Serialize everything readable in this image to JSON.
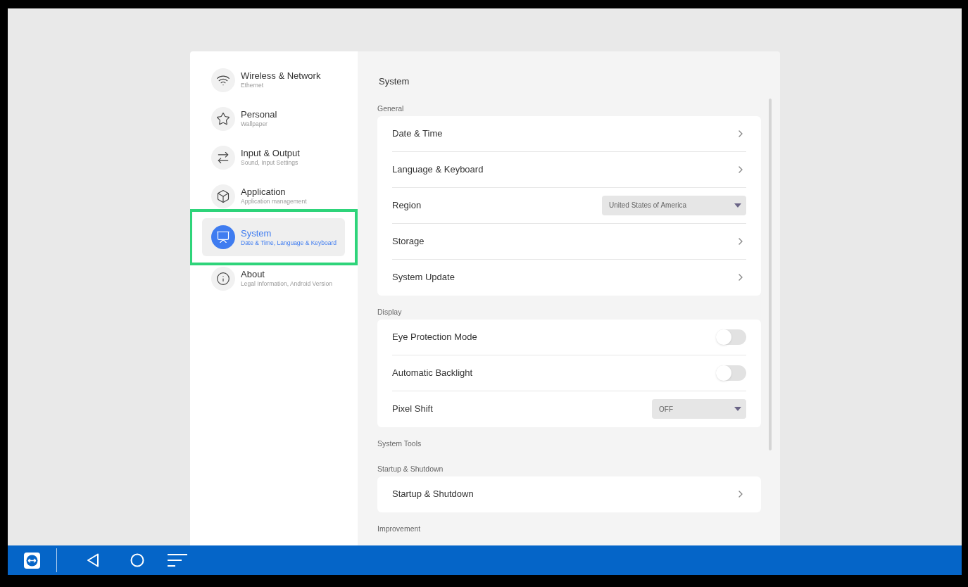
{
  "sidebar": {
    "items": [
      {
        "kind": "wifi",
        "label": "Wireless & Network",
        "sublabel": "Ethernet",
        "selected": false,
        "highlighted": false
      },
      {
        "kind": "star",
        "label": "Personal",
        "sublabel": "Wallpaper",
        "selected": false,
        "highlighted": false
      },
      {
        "kind": "arrows",
        "label": "Input & Output",
        "sublabel": "Sound, Input Settings",
        "selected": false,
        "highlighted": false
      },
      {
        "kind": "cube",
        "label": "Application",
        "sublabel": "Application management",
        "selected": false,
        "highlighted": false
      },
      {
        "kind": "monitor",
        "label": "System",
        "sublabel": "Date & Time, Language & Keyboard",
        "selected": true,
        "highlighted": true
      },
      {
        "kind": "info",
        "label": "About",
        "sublabel": "Legal Information, Android Version",
        "selected": false,
        "highlighted": false
      }
    ]
  },
  "content": {
    "title": "System",
    "sections": [
      {
        "heading": "General",
        "rows": [
          {
            "kind": "link",
            "label": "Date & Time"
          },
          {
            "kind": "link",
            "label": "Language & Keyboard"
          },
          {
            "kind": "select",
            "label": "Region",
            "value": "United States of America"
          },
          {
            "kind": "link",
            "label": "Storage"
          },
          {
            "kind": "link",
            "label": "System Update"
          }
        ]
      },
      {
        "heading": "Display",
        "rows": [
          {
            "kind": "toggle",
            "label": "Eye Protection Mode",
            "on": false
          },
          {
            "kind": "toggle",
            "label": "Automatic Backlight",
            "on": false
          },
          {
            "kind": "select",
            "label": "Pixel Shift",
            "value": "OFF"
          }
        ]
      },
      {
        "heading": "System Tools"
      },
      {
        "heading": "Startup & Shutdown",
        "rows": [
          {
            "kind": "link",
            "label": "Startup & Shutdown"
          }
        ]
      },
      {
        "heading": "Improvement"
      }
    ]
  }
}
